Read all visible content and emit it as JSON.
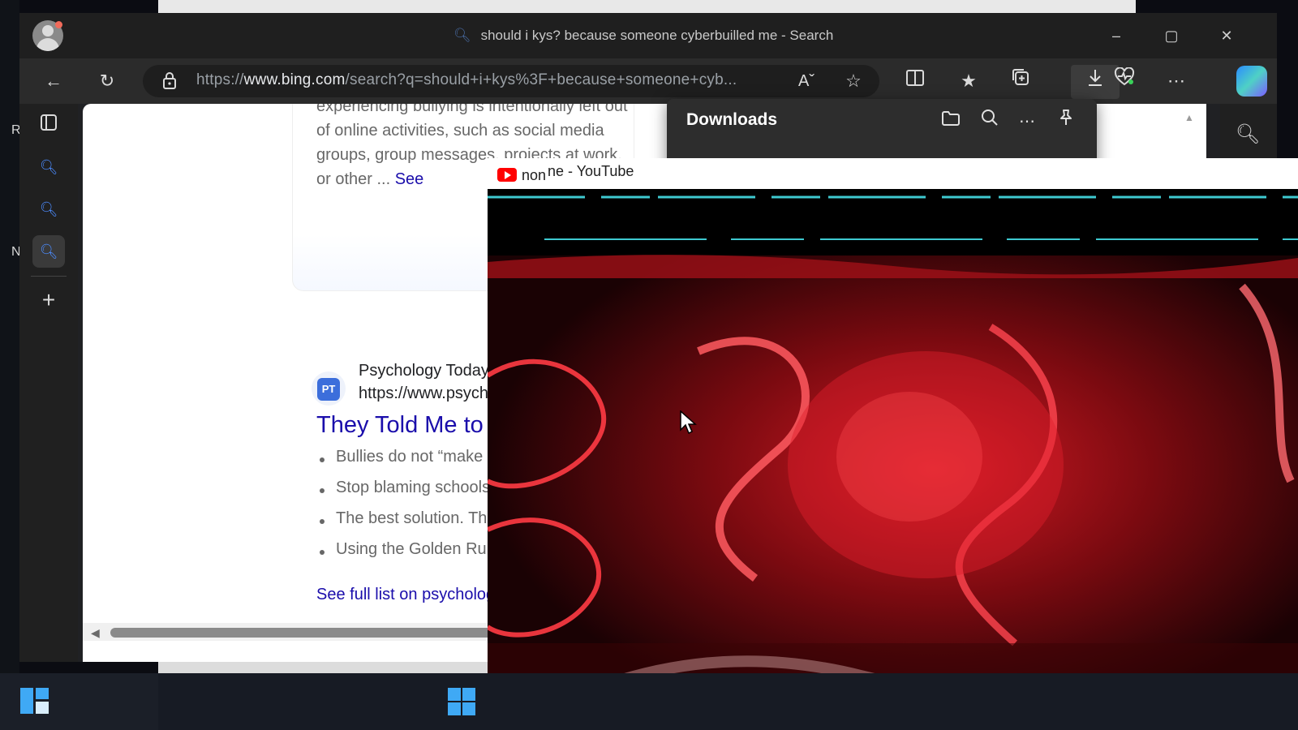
{
  "desktop": {
    "left_text": "R•\nN"
  },
  "browser": {
    "tab_title": "should i kys? because someone cyberbuilled me - Search",
    "address_url_prefix": "https://",
    "address_url_domain": "www.bing.com",
    "address_url_rest": "/search?q=should+i+kys%3F+because+someone+cyb...",
    "toolbar_icons": [
      "back-icon",
      "refresh-icon",
      "lock-icon",
      "read-aloud-icon",
      "favorite-star-icon",
      "split-screen-icon",
      "favorites-icon",
      "collections-icon",
      "downloads-icon",
      "browser-essentials-icon",
      "more-icon",
      "copilot-icon"
    ],
    "window_controls": {
      "minimize": "–",
      "maximize": "▢",
      "close": "✕"
    }
  },
  "page": {
    "snippet_text": "experiencing bullying is intentionally left out of online activities, such as social media groups, group messages, projects at work, or other ...",
    "snippet_more": "See",
    "result": {
      "site_name": "Psychology Today",
      "site_url": "https://www.psycho",
      "logo_text": "PT",
      "title": "They Told Me to K",
      "bullets": [
        "Bullies do not “make us",
        "Stop blaming schools. T",
        "The best solution. The b",
        "Using the Golden Rule. T"
      ],
      "see_full": "See full list on psychology"
    }
  },
  "downloads": {
    "title": "Downloads"
  },
  "youtube_window": {
    "title_fragment": "non",
    "title": "ne - YouTube"
  },
  "colors": {
    "link": "#1a0dab",
    "video_red": "#c0141c",
    "accent": "#3fa9f5"
  }
}
